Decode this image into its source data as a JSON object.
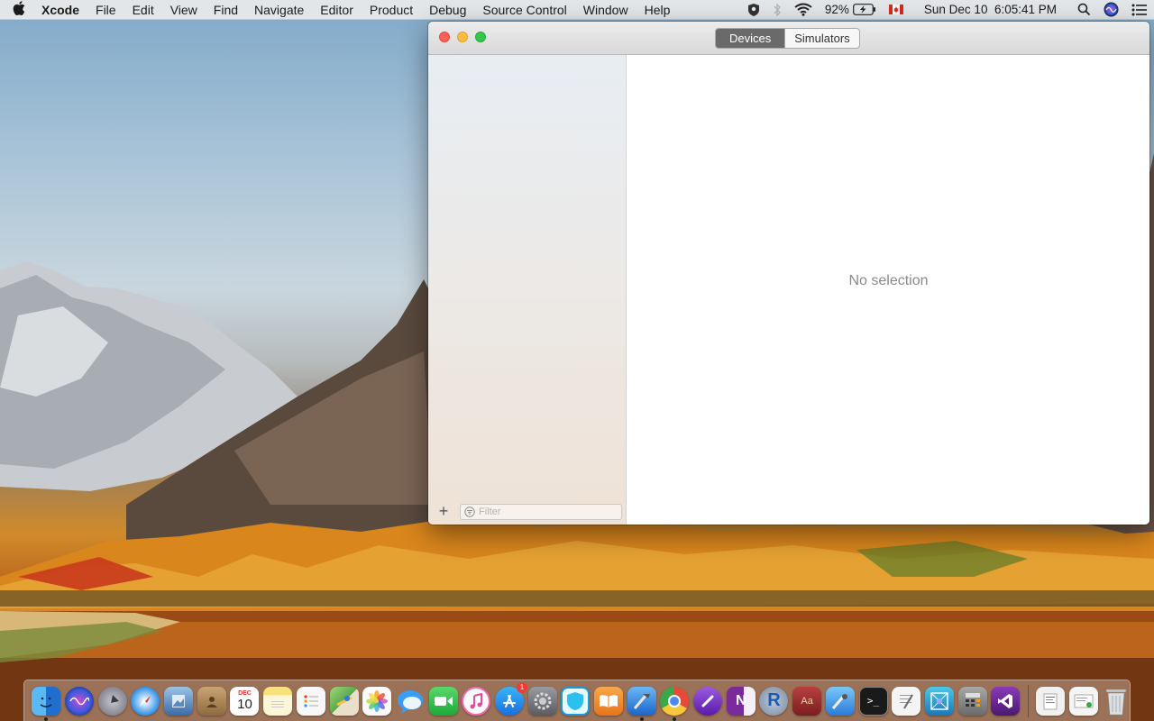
{
  "menubar": {
    "apple_icon": "apple-logo-icon",
    "app_name": "Xcode",
    "items": [
      "File",
      "Edit",
      "View",
      "Find",
      "Navigate",
      "Editor",
      "Product",
      "Debug",
      "Source Control",
      "Window",
      "Help"
    ],
    "status": {
      "battery_percent": "92%",
      "datetime": "Sun Dec 10  6:05:41 PM",
      "icons": [
        "shield-icon",
        "bluetooth-icon",
        "wifi-icon",
        "battery-charging-icon",
        "canada-flag-icon",
        "spotlight-search-icon",
        "siri-icon",
        "notification-center-icon"
      ]
    }
  },
  "window": {
    "app": "Xcode Devices window",
    "tabs": [
      {
        "label": "Devices",
        "selected": true
      },
      {
        "label": "Simulators",
        "selected": false
      }
    ],
    "sidebar": {
      "add_label": "+",
      "filter_placeholder": "Filter"
    },
    "detail": {
      "empty_message": "No selection"
    }
  },
  "dock": {
    "calendar_date": "10",
    "calendar_month": "DEC",
    "app_store_badge": "1",
    "items": [
      {
        "name": "finder-icon",
        "color": "#2a8ff0"
      },
      {
        "name": "siri-icon",
        "color": "#3a2a7a"
      },
      {
        "name": "launchpad-icon",
        "color": "#8a8a96"
      },
      {
        "name": "safari-icon",
        "color": "#2d8fe6"
      },
      {
        "name": "preview-icon",
        "color": "#4f7fb8"
      },
      {
        "name": "contacts-icon",
        "color": "#b28a5a"
      },
      {
        "name": "calendar-icon",
        "color": "#ffffff"
      },
      {
        "name": "notes-icon",
        "color": "#f6e07a"
      },
      {
        "name": "reminders-icon",
        "color": "#f2f2f2"
      },
      {
        "name": "maps-icon",
        "color": "#6fbe5a"
      },
      {
        "name": "photos-icon",
        "color": "#f5f5f5"
      },
      {
        "name": "messages-icon",
        "color": "#3a9df5"
      },
      {
        "name": "facetime-icon",
        "color": "#2fbf4a"
      },
      {
        "name": "itunes-icon",
        "color": "#f062b0"
      },
      {
        "name": "app-store-icon",
        "color": "#1a8cf0"
      },
      {
        "name": "system-preferences-icon",
        "color": "#7a7a80"
      },
      {
        "name": "shield-app-icon",
        "color": "#2bb6e8"
      },
      {
        "name": "ibooks-icon",
        "color": "#f08a24"
      },
      {
        "name": "xcode-icon",
        "color": "#2c78d8"
      },
      {
        "name": "chrome-icon",
        "color": "#e9e9e9"
      },
      {
        "name": "usb-tool-icon",
        "color": "#7a3ac8"
      },
      {
        "name": "onenote-icon",
        "color": "#7a2a9a"
      },
      {
        "name": "r-language-icon",
        "color": "#2a6ac0"
      },
      {
        "name": "dictionary-icon",
        "color": "#9a2a2a"
      },
      {
        "name": "instruments-icon",
        "color": "#3a8ad8"
      },
      {
        "name": "terminal-icon",
        "color": "#1a1a1a"
      },
      {
        "name": "textedit-icon",
        "color": "#f2f2f2"
      },
      {
        "name": "network-utility-icon",
        "color": "#1e8ec8"
      },
      {
        "name": "calculator-icon",
        "color": "#8a8a8a"
      },
      {
        "name": "visual-studio-icon",
        "color": "#68217a"
      },
      {
        "name": "script-editor-icon",
        "color": "#f0f0f0"
      },
      {
        "name": "mail-draft-icon",
        "color": "#f4f4f4"
      },
      {
        "name": "trash-icon",
        "color": "#d6d9dc"
      }
    ]
  }
}
